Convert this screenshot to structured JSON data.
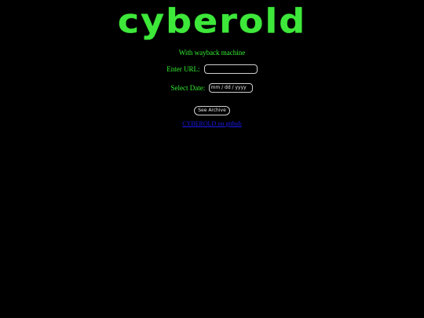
{
  "logo": {
    "text": "cyberold"
  },
  "subtitle": "With wayback machine",
  "url_field": {
    "label": "Enter URL:",
    "value": ""
  },
  "date_field": {
    "label": "Select Date:",
    "placeholder": "mm / dd / yyyy"
  },
  "submit": {
    "label": "See Archive"
  },
  "footer_link": {
    "text": "CYBEROLD on github"
  },
  "colors": {
    "background": "#000000",
    "accent": "#33ee33",
    "link": "#1a1aee"
  }
}
